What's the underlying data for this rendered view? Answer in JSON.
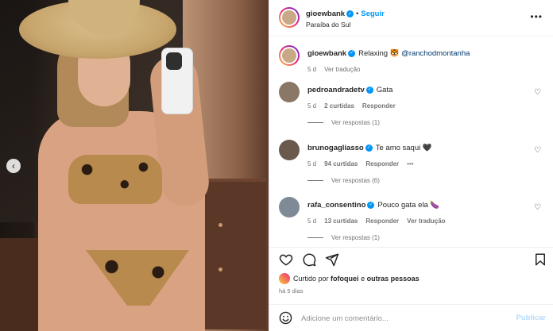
{
  "post": {
    "author": "gioewbank",
    "follow_label": "Seguir",
    "separator": "•",
    "location": "Paraíba do Sul",
    "more_label": "•••"
  },
  "caption": {
    "author": "gioewbank",
    "text": "Relaxing 🐯",
    "mention": "@ranchodmontanha",
    "age": "5 d",
    "translate": "Ver tradução"
  },
  "comments": [
    {
      "author": "pedroandradetv",
      "text": "Gata",
      "age": "5 d",
      "likes": "2 curtidas",
      "reply": "Responder",
      "view_replies": "Ver respostas (1)"
    },
    {
      "author": "brunogagliasso",
      "text": "Te amo saqui 🖤",
      "age": "5 d",
      "likes": "94 curtidas",
      "reply": "Responder",
      "options": "•••",
      "view_replies": "Ver respostas (6)"
    },
    {
      "author": "rafa_consentino",
      "text": "Pouco gata ela 🍆",
      "age": "5 d",
      "likes": "13 curtidas",
      "reply": "Responder",
      "translate": "Ver tradução",
      "view_replies": "Ver respostas (1)"
    }
  ],
  "likes": {
    "prefix": "Curtido por",
    "user": "fofoquei",
    "conj": "e",
    "others": "outras pessoas"
  },
  "time_ago": "há 5 dias",
  "add_comment": {
    "placeholder": "Adicione um comentário...",
    "post_label": "Publicar"
  },
  "carousel": {
    "prev_label": "‹"
  },
  "icons": {
    "heart": "heart-icon",
    "comment": "comment-icon",
    "share": "share-icon",
    "save": "bookmark-icon",
    "emoji": "smile-icon"
  },
  "colors": {
    "link_blue": "#0095f6",
    "verified": "#0095f6",
    "mention": "#00376b",
    "muted": "#737373",
    "post_disabled": "#b3dbff"
  }
}
